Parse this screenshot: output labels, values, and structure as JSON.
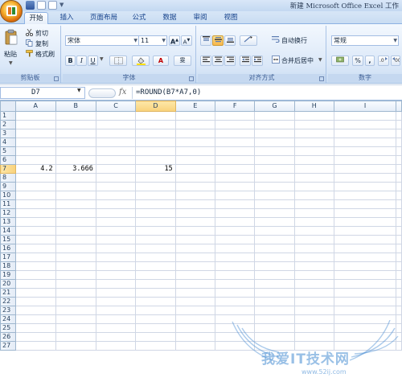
{
  "window": {
    "title": "新建 Microsoft Office Excel 工作"
  },
  "quick_access": {
    "icons": [
      "save-icon",
      "undo-icon",
      "redo-icon",
      "customize-arrow-icon"
    ]
  },
  "ribbon_tabs": [
    "开始",
    "插入",
    "页面布局",
    "公式",
    "数据",
    "审阅",
    "视图"
  ],
  "active_tab": "开始",
  "clipboard": {
    "paste_label": "粘贴",
    "cut_label": "剪切",
    "copy_label": "复制",
    "format_painter_label": "格式刷",
    "group_label": "剪贴板"
  },
  "font": {
    "font_name": "宋体",
    "font_size": "11",
    "bold_label": "B",
    "italic_label": "I",
    "underline_label": "U",
    "grow_label": "A",
    "shrink_label": "A",
    "font_color_label": "A",
    "wen_label": "雯",
    "group_label": "字体"
  },
  "alignment": {
    "wrap_text_label": "自动换行",
    "merge_center_label": "合并后居中",
    "group_label": "对齐方式"
  },
  "number": {
    "format_value": "常规",
    "percent_label": "%",
    "comma_label": ",",
    "group_label": "数字"
  },
  "formula_bar": {
    "name_box": "D7",
    "fx_label": "fx",
    "formula": "=ROUND(B7*A7,0)"
  },
  "sheet": {
    "columns": [
      "A",
      "B",
      "C",
      "D",
      "E",
      "F",
      "G",
      "H",
      "I"
    ],
    "selected_column": "D",
    "selected_row": 7,
    "rows": [
      {
        "row": 1,
        "cells": [
          "",
          "",
          "",
          "",
          "",
          "",
          "",
          "",
          ""
        ]
      },
      {
        "row": 2,
        "cells": [
          "",
          "",
          "",
          "",
          "",
          "",
          "",
          "",
          ""
        ]
      },
      {
        "row": 3,
        "cells": [
          "",
          "",
          "",
          "",
          "",
          "",
          "",
          "",
          ""
        ]
      },
      {
        "row": 4,
        "cells": [
          "",
          "",
          "",
          "",
          "",
          "",
          "",
          "",
          ""
        ]
      },
      {
        "row": 5,
        "cells": [
          "",
          "",
          "",
          "",
          "",
          "",
          "",
          "",
          ""
        ]
      },
      {
        "row": 6,
        "cells": [
          "",
          "",
          "",
          "",
          "",
          "",
          "",
          "",
          ""
        ]
      },
      {
        "row": 7,
        "cells": [
          "4.2",
          "3.666",
          "",
          "15",
          "",
          "",
          "",
          "",
          ""
        ]
      },
      {
        "row": 8,
        "cells": [
          "",
          "",
          "",
          "",
          "",
          "",
          "",
          "",
          ""
        ]
      },
      {
        "row": 9,
        "cells": [
          "",
          "",
          "",
          "",
          "",
          "",
          "",
          "",
          ""
        ]
      },
      {
        "row": 10,
        "cells": [
          "",
          "",
          "",
          "",
          "",
          "",
          "",
          "",
          ""
        ]
      },
      {
        "row": 11,
        "cells": [
          "",
          "",
          "",
          "",
          "",
          "",
          "",
          "",
          ""
        ]
      },
      {
        "row": 12,
        "cells": [
          "",
          "",
          "",
          "",
          "",
          "",
          "",
          "",
          ""
        ]
      },
      {
        "row": 13,
        "cells": [
          "",
          "",
          "",
          "",
          "",
          "",
          "",
          "",
          ""
        ]
      },
      {
        "row": 14,
        "cells": [
          "",
          "",
          "",
          "",
          "",
          "",
          "",
          "",
          ""
        ]
      },
      {
        "row": 15,
        "cells": [
          "",
          "",
          "",
          "",
          "",
          "",
          "",
          "",
          ""
        ]
      },
      {
        "row": 16,
        "cells": [
          "",
          "",
          "",
          "",
          "",
          "",
          "",
          "",
          ""
        ]
      },
      {
        "row": 17,
        "cells": [
          "",
          "",
          "",
          "",
          "",
          "",
          "",
          "",
          ""
        ]
      },
      {
        "row": 18,
        "cells": [
          "",
          "",
          "",
          "",
          "",
          "",
          "",
          "",
          ""
        ]
      },
      {
        "row": 19,
        "cells": [
          "",
          "",
          "",
          "",
          "",
          "",
          "",
          "",
          ""
        ]
      },
      {
        "row": 20,
        "cells": [
          "",
          "",
          "",
          "",
          "",
          "",
          "",
          "",
          ""
        ]
      },
      {
        "row": 21,
        "cells": [
          "",
          "",
          "",
          "",
          "",
          "",
          "",
          "",
          ""
        ]
      },
      {
        "row": 22,
        "cells": [
          "",
          "",
          "",
          "",
          "",
          "",
          "",
          "",
          ""
        ]
      },
      {
        "row": 23,
        "cells": [
          "",
          "",
          "",
          "",
          "",
          "",
          "",
          "",
          ""
        ]
      },
      {
        "row": 24,
        "cells": [
          "",
          "",
          "",
          "",
          "",
          "",
          "",
          "",
          ""
        ]
      },
      {
        "row": 25,
        "cells": [
          "",
          "",
          "",
          "",
          "",
          "",
          "",
          "",
          ""
        ]
      },
      {
        "row": 26,
        "cells": [
          "",
          "",
          "",
          "",
          "",
          "",
          "",
          "",
          ""
        ]
      },
      {
        "row": 27,
        "cells": [
          "",
          "",
          "",
          "",
          "",
          "",
          "",
          "",
          ""
        ]
      }
    ]
  },
  "watermark": {
    "text": "我爱IT技术网",
    "url": "www.52ij.com"
  },
  "colors": {
    "ribbon_bg": "#dbe8f8",
    "tab_text": "#15428b",
    "header_bg": "#e4ecf7",
    "header_selected": "#f9d27b",
    "gridline": "#d0d7e5",
    "watermark": "#468cd2"
  }
}
